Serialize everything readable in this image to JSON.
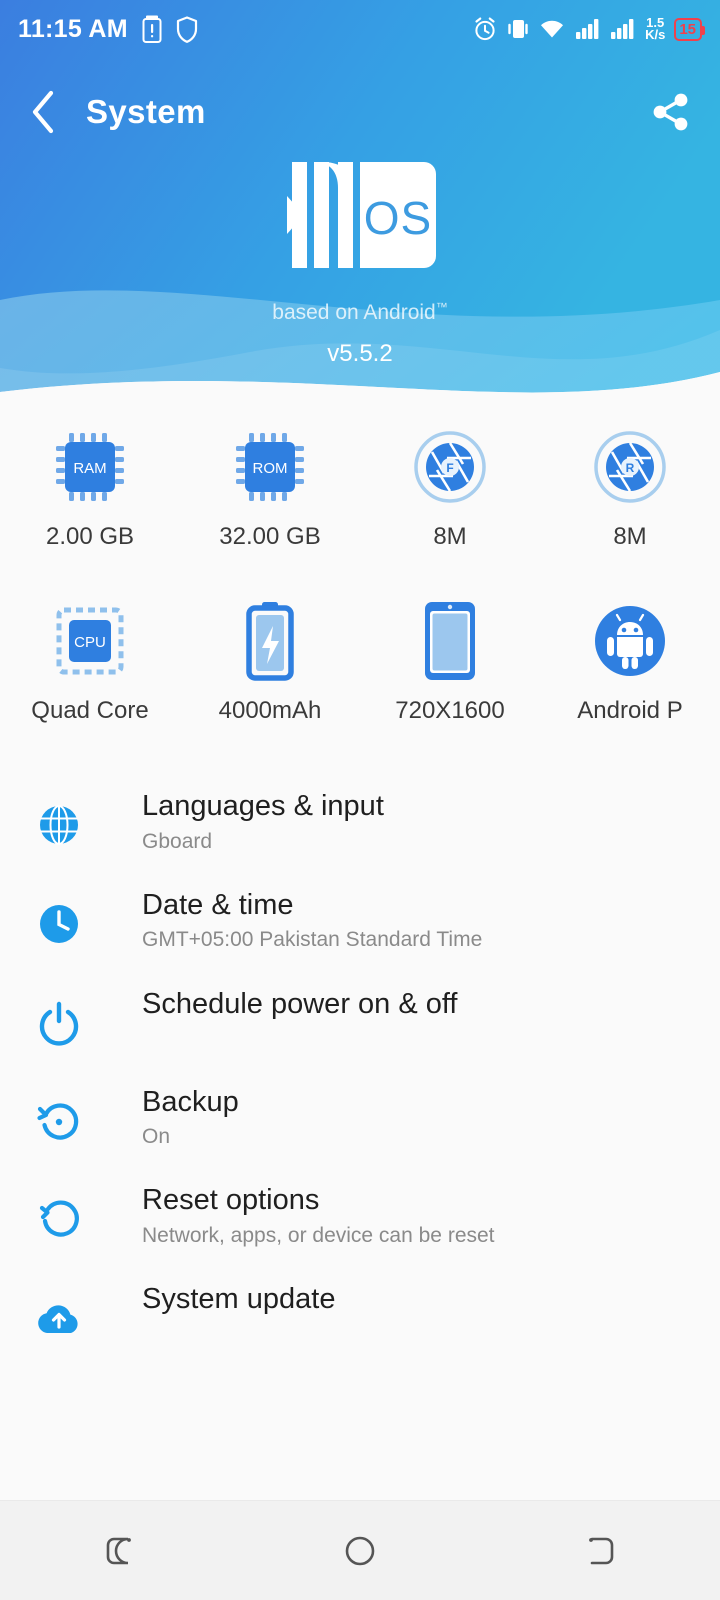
{
  "statusbar": {
    "time": "11:15 AM",
    "icons": [
      "battery-alert-icon",
      "shield-icon",
      "alarm-icon",
      "vibrate-icon",
      "wifi-icon",
      "signal-sim1-icon",
      "signal-sim2-icon"
    ],
    "net_speed_value": "1.5",
    "net_speed_unit": "K/s",
    "battery_percent": "15"
  },
  "appbar": {
    "back_icon": "chevron-left-icon",
    "title": "System",
    "share_icon": "share-icon"
  },
  "hero": {
    "logo_text": "OS",
    "logo_name": "xos-logo",
    "based_on": "based on Android",
    "trademark": "™",
    "version": "v5.5.2",
    "gradient_from": "#3B7EE0",
    "gradient_to": "#35AEE0"
  },
  "specs": [
    [
      {
        "icon": "ram-chip-icon",
        "badge": "RAM",
        "label": "2.00 GB"
      },
      {
        "icon": "rom-chip-icon",
        "badge": "ROM",
        "label": "32.00 GB"
      },
      {
        "icon": "front-camera-icon",
        "badge": "F",
        "label": "8M"
      },
      {
        "icon": "rear-camera-icon",
        "badge": "R",
        "label": "8M"
      }
    ],
    [
      {
        "icon": "cpu-chip-icon",
        "badge": "CPU",
        "label": "Quad Core"
      },
      {
        "icon": "battery-icon",
        "badge": "",
        "label": "4000mAh"
      },
      {
        "icon": "screen-icon",
        "badge": "",
        "label": "720X1600"
      },
      {
        "icon": "android-icon",
        "badge": "",
        "label": "Android P"
      }
    ]
  ],
  "settings": [
    {
      "icon": "globe-icon",
      "title": "Languages & input",
      "subtitle": "Gboard"
    },
    {
      "icon": "clock-icon",
      "title": "Date & time",
      "subtitle": "GMT+05:00 Pakistan Standard Time"
    },
    {
      "icon": "power-icon",
      "title": "Schedule power on & off",
      "subtitle": ""
    },
    {
      "icon": "backup-icon",
      "title": "Backup",
      "subtitle": "On"
    },
    {
      "icon": "reset-icon",
      "title": "Reset options",
      "subtitle": "Network, apps, or device can be reset"
    },
    {
      "icon": "cloud-upload-icon",
      "title": "System update",
      "subtitle": ""
    }
  ],
  "navbar": {
    "recents_label": "recents-icon",
    "home_label": "home-icon",
    "back_label": "back-icon"
  },
  "colors": {
    "accent": "#1E9BE9",
    "chip_blue": "#2F7FE0",
    "content_bg": "#FAFAFA",
    "battery_red": "#F0414C"
  }
}
